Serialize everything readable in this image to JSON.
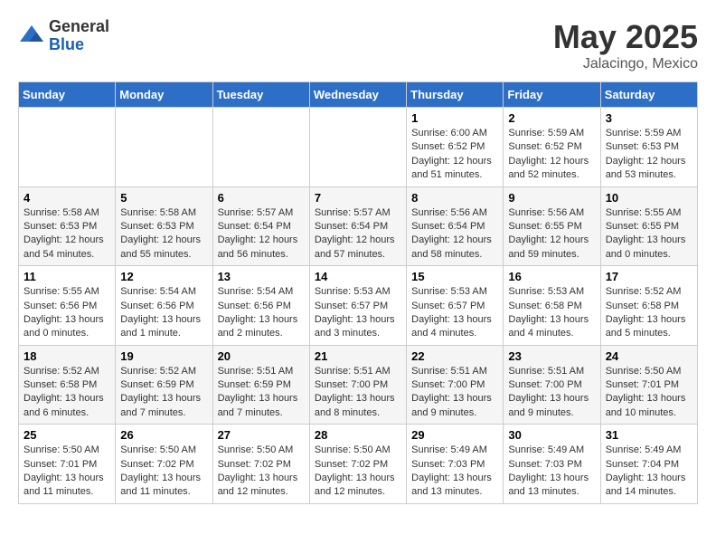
{
  "header": {
    "logo_general": "General",
    "logo_blue": "Blue",
    "month": "May 2025",
    "location": "Jalacingo, Mexico"
  },
  "days_of_week": [
    "Sunday",
    "Monday",
    "Tuesday",
    "Wednesday",
    "Thursday",
    "Friday",
    "Saturday"
  ],
  "weeks": [
    [
      {
        "day": "",
        "info": ""
      },
      {
        "day": "",
        "info": ""
      },
      {
        "day": "",
        "info": ""
      },
      {
        "day": "",
        "info": ""
      },
      {
        "day": "1",
        "info": "Sunrise: 6:00 AM\nSunset: 6:52 PM\nDaylight: 12 hours\nand 51 minutes."
      },
      {
        "day": "2",
        "info": "Sunrise: 5:59 AM\nSunset: 6:52 PM\nDaylight: 12 hours\nand 52 minutes."
      },
      {
        "day": "3",
        "info": "Sunrise: 5:59 AM\nSunset: 6:53 PM\nDaylight: 12 hours\nand 53 minutes."
      }
    ],
    [
      {
        "day": "4",
        "info": "Sunrise: 5:58 AM\nSunset: 6:53 PM\nDaylight: 12 hours\nand 54 minutes."
      },
      {
        "day": "5",
        "info": "Sunrise: 5:58 AM\nSunset: 6:53 PM\nDaylight: 12 hours\nand 55 minutes."
      },
      {
        "day": "6",
        "info": "Sunrise: 5:57 AM\nSunset: 6:54 PM\nDaylight: 12 hours\nand 56 minutes."
      },
      {
        "day": "7",
        "info": "Sunrise: 5:57 AM\nSunset: 6:54 PM\nDaylight: 12 hours\nand 57 minutes."
      },
      {
        "day": "8",
        "info": "Sunrise: 5:56 AM\nSunset: 6:54 PM\nDaylight: 12 hours\nand 58 minutes."
      },
      {
        "day": "9",
        "info": "Sunrise: 5:56 AM\nSunset: 6:55 PM\nDaylight: 12 hours\nand 59 minutes."
      },
      {
        "day": "10",
        "info": "Sunrise: 5:55 AM\nSunset: 6:55 PM\nDaylight: 13 hours\nand 0 minutes."
      }
    ],
    [
      {
        "day": "11",
        "info": "Sunrise: 5:55 AM\nSunset: 6:56 PM\nDaylight: 13 hours\nand 0 minutes."
      },
      {
        "day": "12",
        "info": "Sunrise: 5:54 AM\nSunset: 6:56 PM\nDaylight: 13 hours\nand 1 minute."
      },
      {
        "day": "13",
        "info": "Sunrise: 5:54 AM\nSunset: 6:56 PM\nDaylight: 13 hours\nand 2 minutes."
      },
      {
        "day": "14",
        "info": "Sunrise: 5:53 AM\nSunset: 6:57 PM\nDaylight: 13 hours\nand 3 minutes."
      },
      {
        "day": "15",
        "info": "Sunrise: 5:53 AM\nSunset: 6:57 PM\nDaylight: 13 hours\nand 4 minutes."
      },
      {
        "day": "16",
        "info": "Sunrise: 5:53 AM\nSunset: 6:58 PM\nDaylight: 13 hours\nand 4 minutes."
      },
      {
        "day": "17",
        "info": "Sunrise: 5:52 AM\nSunset: 6:58 PM\nDaylight: 13 hours\nand 5 minutes."
      }
    ],
    [
      {
        "day": "18",
        "info": "Sunrise: 5:52 AM\nSunset: 6:58 PM\nDaylight: 13 hours\nand 6 minutes."
      },
      {
        "day": "19",
        "info": "Sunrise: 5:52 AM\nSunset: 6:59 PM\nDaylight: 13 hours\nand 7 minutes."
      },
      {
        "day": "20",
        "info": "Sunrise: 5:51 AM\nSunset: 6:59 PM\nDaylight: 13 hours\nand 7 minutes."
      },
      {
        "day": "21",
        "info": "Sunrise: 5:51 AM\nSunset: 7:00 PM\nDaylight: 13 hours\nand 8 minutes."
      },
      {
        "day": "22",
        "info": "Sunrise: 5:51 AM\nSunset: 7:00 PM\nDaylight: 13 hours\nand 9 minutes."
      },
      {
        "day": "23",
        "info": "Sunrise: 5:51 AM\nSunset: 7:00 PM\nDaylight: 13 hours\nand 9 minutes."
      },
      {
        "day": "24",
        "info": "Sunrise: 5:50 AM\nSunset: 7:01 PM\nDaylight: 13 hours\nand 10 minutes."
      }
    ],
    [
      {
        "day": "25",
        "info": "Sunrise: 5:50 AM\nSunset: 7:01 PM\nDaylight: 13 hours\nand 11 minutes."
      },
      {
        "day": "26",
        "info": "Sunrise: 5:50 AM\nSunset: 7:02 PM\nDaylight: 13 hours\nand 11 minutes."
      },
      {
        "day": "27",
        "info": "Sunrise: 5:50 AM\nSunset: 7:02 PM\nDaylight: 13 hours\nand 12 minutes."
      },
      {
        "day": "28",
        "info": "Sunrise: 5:50 AM\nSunset: 7:02 PM\nDaylight: 13 hours\nand 12 minutes."
      },
      {
        "day": "29",
        "info": "Sunrise: 5:49 AM\nSunset: 7:03 PM\nDaylight: 13 hours\nand 13 minutes."
      },
      {
        "day": "30",
        "info": "Sunrise: 5:49 AM\nSunset: 7:03 PM\nDaylight: 13 hours\nand 13 minutes."
      },
      {
        "day": "31",
        "info": "Sunrise: 5:49 AM\nSunset: 7:04 PM\nDaylight: 13 hours\nand 14 minutes."
      }
    ]
  ]
}
